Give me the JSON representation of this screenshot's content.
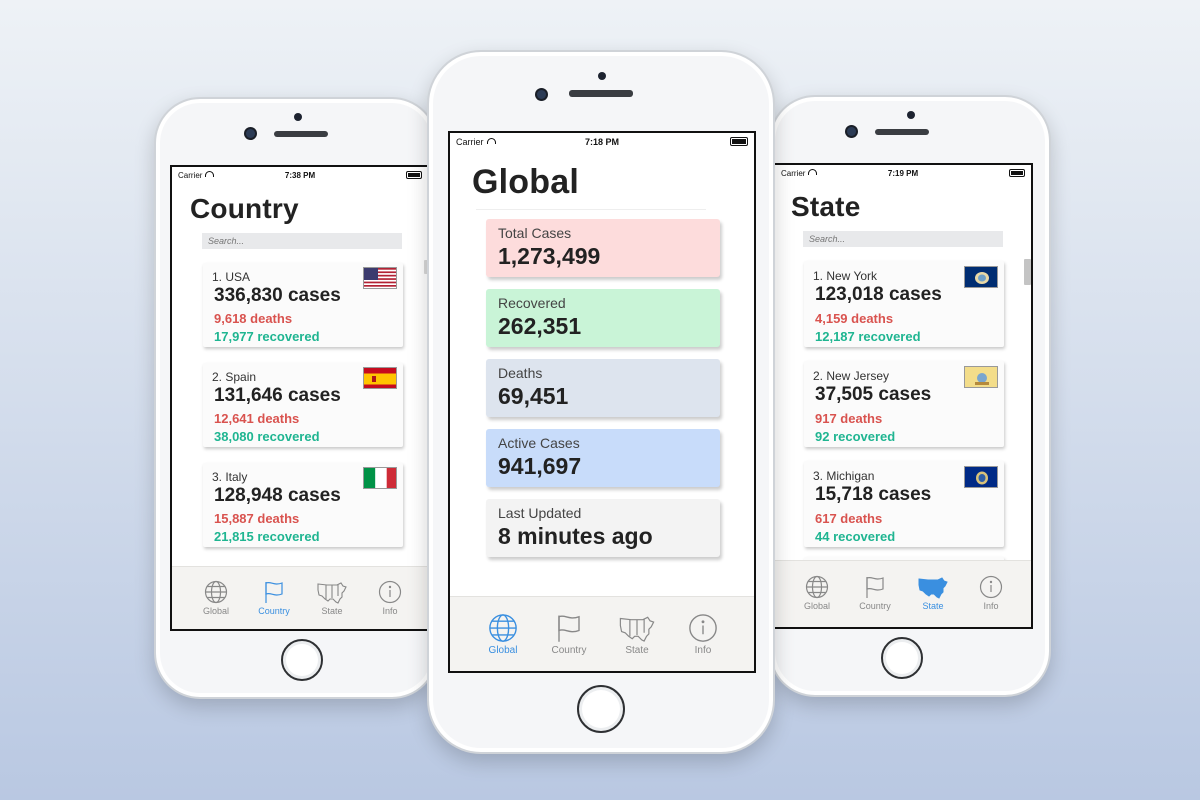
{
  "colors": {
    "active_tab": "#3a8fe0",
    "inactive_tab": "#888888",
    "deaths": "#d9534f",
    "recovered": "#1fb591",
    "total_cases_bg": "#fddcdc",
    "recovered_bg": "#c9f4d7",
    "deaths_bg": "#dde4ee",
    "active_bg": "#c8dcfa",
    "updated_bg": "#f3f3f3"
  },
  "tabs": [
    {
      "label": "Global",
      "icon": "globe-icon"
    },
    {
      "label": "Country",
      "icon": "flag-icon"
    },
    {
      "label": "State",
      "icon": "us-map-icon"
    },
    {
      "label": "Info",
      "icon": "info-icon"
    }
  ],
  "country_screen": {
    "status": {
      "carrier": "Carrier",
      "time": "7:38 PM"
    },
    "title": "Country",
    "search_placeholder": "Search...",
    "items": [
      {
        "rank": "1. USA",
        "cases": "336,830 cases",
        "deaths": "9,618 deaths",
        "recovered": "17,977 recovered",
        "flag": "usa-flag-icon"
      },
      {
        "rank": "2. Spain",
        "cases": "131,646 cases",
        "deaths": "12,641 deaths",
        "recovered": "38,080 recovered",
        "flag": "spain-flag-icon"
      },
      {
        "rank": "3. Italy",
        "cases": "128,948 cases",
        "deaths": "15,887 deaths",
        "recovered": "21,815 recovered",
        "flag": "italy-flag-icon"
      }
    ],
    "active_tab": "Country"
  },
  "global_screen": {
    "status": {
      "carrier": "Carrier",
      "time": "7:18 PM"
    },
    "title": "Global",
    "stats": [
      {
        "label": "Total Cases",
        "value": "1,273,499"
      },
      {
        "label": "Recovered",
        "value": "262,351"
      },
      {
        "label": "Deaths",
        "value": "69,451"
      },
      {
        "label": "Active Cases",
        "value": "941,697"
      },
      {
        "label": "Last Updated",
        "value": "8 minutes ago"
      }
    ],
    "active_tab": "Global"
  },
  "state_screen": {
    "status": {
      "carrier": "Carrier",
      "time": "7:19 PM"
    },
    "title": "State",
    "search_placeholder": "Search...",
    "items": [
      {
        "rank": "1. New York",
        "cases": "123,018 cases",
        "deaths": "4,159 deaths",
        "recovered": "12,187 recovered",
        "flag": "new-york-flag-icon"
      },
      {
        "rank": "2. New Jersey",
        "cases": "37,505 cases",
        "deaths": "917 deaths",
        "recovered": "92 recovered",
        "flag": "new-jersey-flag-icon"
      },
      {
        "rank": "3. Michigan",
        "cases": "15,718 cases",
        "deaths": "617 deaths",
        "recovered": "44 recovered",
        "flag": "michigan-flag-icon"
      }
    ],
    "active_tab": "State"
  }
}
